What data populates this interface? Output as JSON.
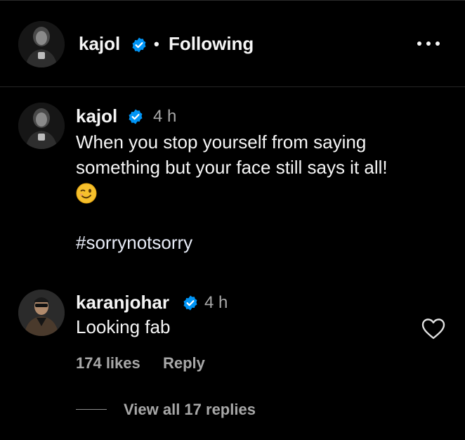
{
  "header": {
    "username": "kajol",
    "separator": "•",
    "follow_status": "Following"
  },
  "post": {
    "username": "kajol",
    "time": "4 h",
    "caption": "When you stop yourself from saying something but your face still says it all!",
    "emoji": "winking-face",
    "hashtag": "#sorrynotsorry"
  },
  "comment": {
    "username": "karanjohar",
    "time": "4 h",
    "text": "Looking fab",
    "likes": "174 likes",
    "reply_label": "Reply",
    "view_replies": "View all 17 replies"
  },
  "colors": {
    "background": "#000000",
    "text": "#f5f5f5",
    "muted": "#a8a8a8",
    "verified": "#0095f6"
  }
}
